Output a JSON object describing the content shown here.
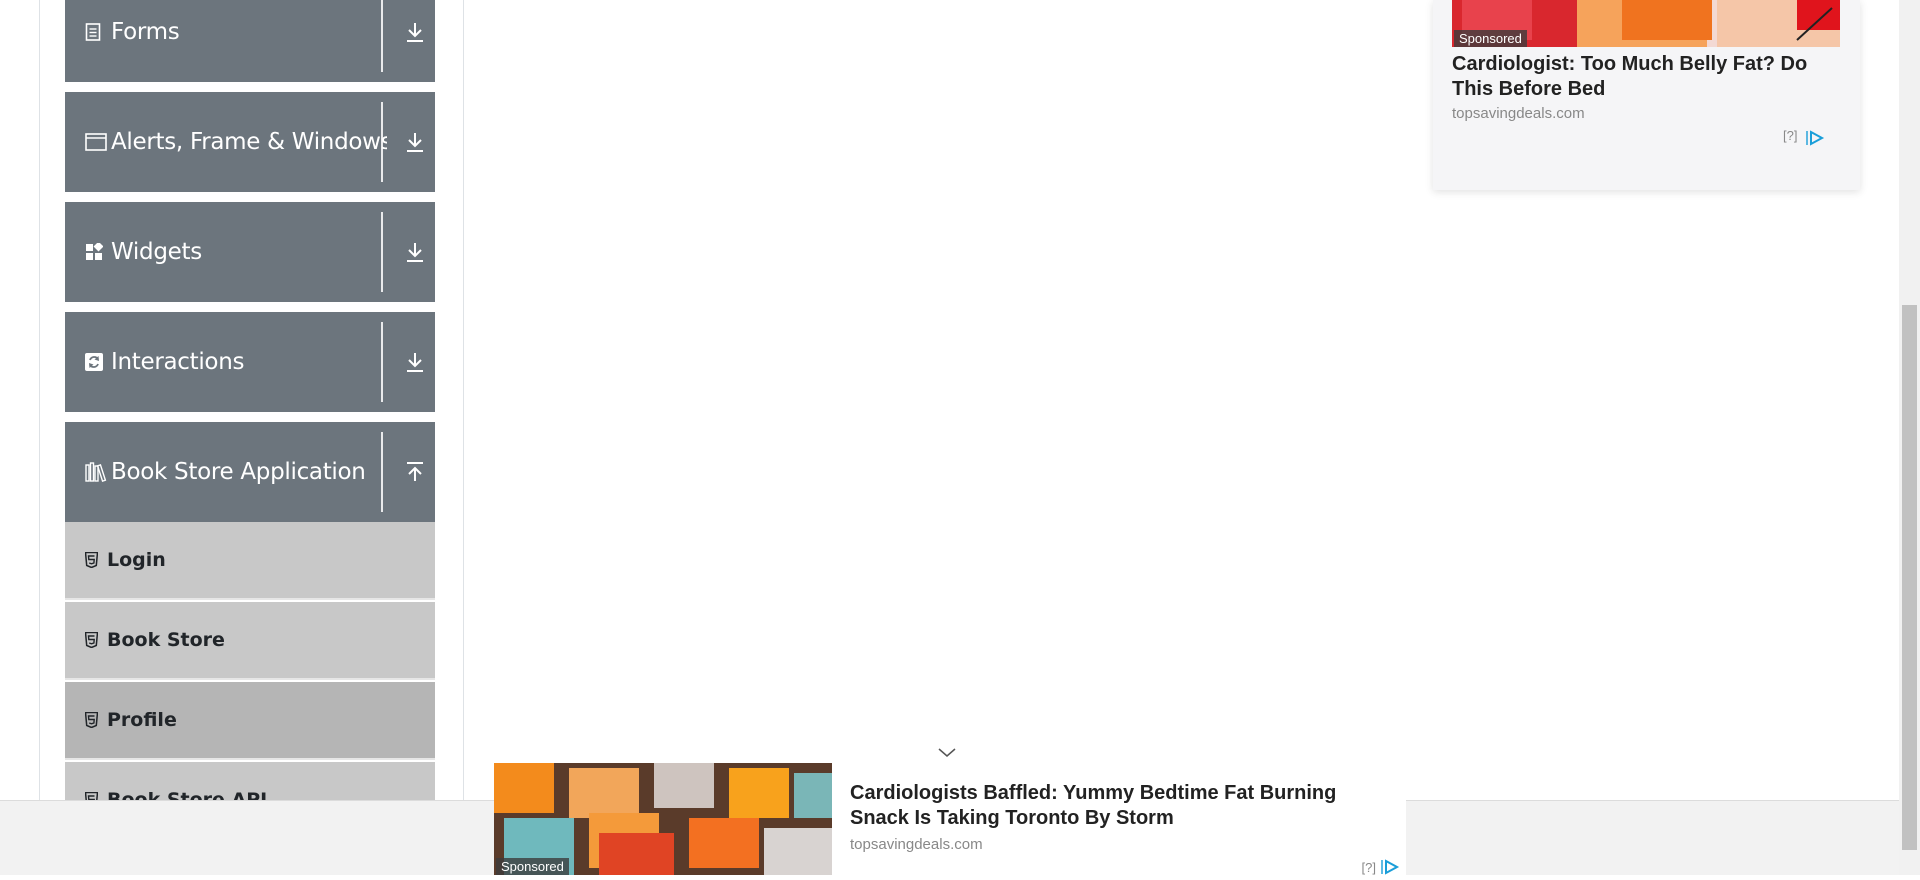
{
  "sidebar": {
    "groups": [
      {
        "label": "Forms",
        "icon": "form-icon",
        "expanded": false
      },
      {
        "label": "Alerts, Frame & Windows",
        "icon": "window-icon",
        "expanded": false
      },
      {
        "label": "Widgets",
        "icon": "widgets-icon",
        "expanded": false
      },
      {
        "label": "Interactions",
        "icon": "interactions-icon",
        "expanded": false
      },
      {
        "label": "Book Store Application",
        "icon": "books-icon",
        "expanded": true
      }
    ],
    "book_store_items": [
      {
        "label": "Login",
        "icon": "html5-icon",
        "active": false
      },
      {
        "label": "Book Store",
        "icon": "html5-icon",
        "active": false
      },
      {
        "label": "Profile",
        "icon": "html5-icon",
        "active": true
      },
      {
        "label": "Book Store API",
        "icon": "html5-icon",
        "active": false
      }
    ]
  },
  "side_ad": {
    "sponsored": "Sponsored",
    "headline": "Cardiologist: Too Much Belly Fat? Do This Before Bed",
    "source": "topsavingdeals.com",
    "help": "[?]"
  },
  "bottom_ad": {
    "sponsored": "Sponsored",
    "headline": "Cardiologists Baffled: Yummy Bedtime Fat Burning Snack Is Taking Toronto By Storm",
    "source": "topsavingdeals.com",
    "help": "[?]"
  },
  "colors": {
    "group_header_bg": "#6c757d",
    "menu_item_bg": "#c8c8c8",
    "menu_item_active_bg": "#b5b5b5",
    "adchoices_blue": "#1a9ed9"
  }
}
